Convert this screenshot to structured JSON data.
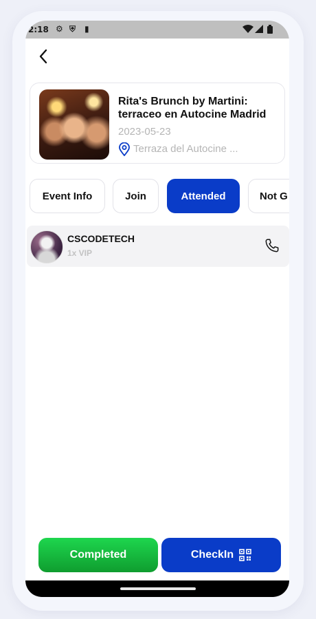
{
  "status_bar": {
    "time": "2:18",
    "left_icons": [
      "gear-icon",
      "shield-icon",
      "sd-card-icon"
    ],
    "right_icons": [
      "wifi-icon",
      "signal-icon",
      "battery-icon"
    ]
  },
  "header": {
    "back_icon": "chevron-left-icon"
  },
  "event": {
    "title": "Rita's Brunch by Martini: terraceo en Autocine Madrid",
    "date": "2023-05-23",
    "location": "Terraza del Autocine ...",
    "location_icon": "map-pin-icon"
  },
  "tabs": [
    {
      "label": "Event Info",
      "active": false
    },
    {
      "label": "Join",
      "active": false
    },
    {
      "label": "Attended",
      "active": true
    },
    {
      "label": "Not G",
      "active": false
    }
  ],
  "attendees": [
    {
      "name": "CSCODETECH",
      "ticket": "1x VIP",
      "action_icon": "phone-icon"
    }
  ],
  "actions": {
    "completed_label": "Completed",
    "checkin_label": "CheckIn",
    "checkin_icon": "qr-code-icon"
  },
  "colors": {
    "primary": "#0a3cc8",
    "success": "#14b83a",
    "muted_text": "#b5b5b5"
  }
}
